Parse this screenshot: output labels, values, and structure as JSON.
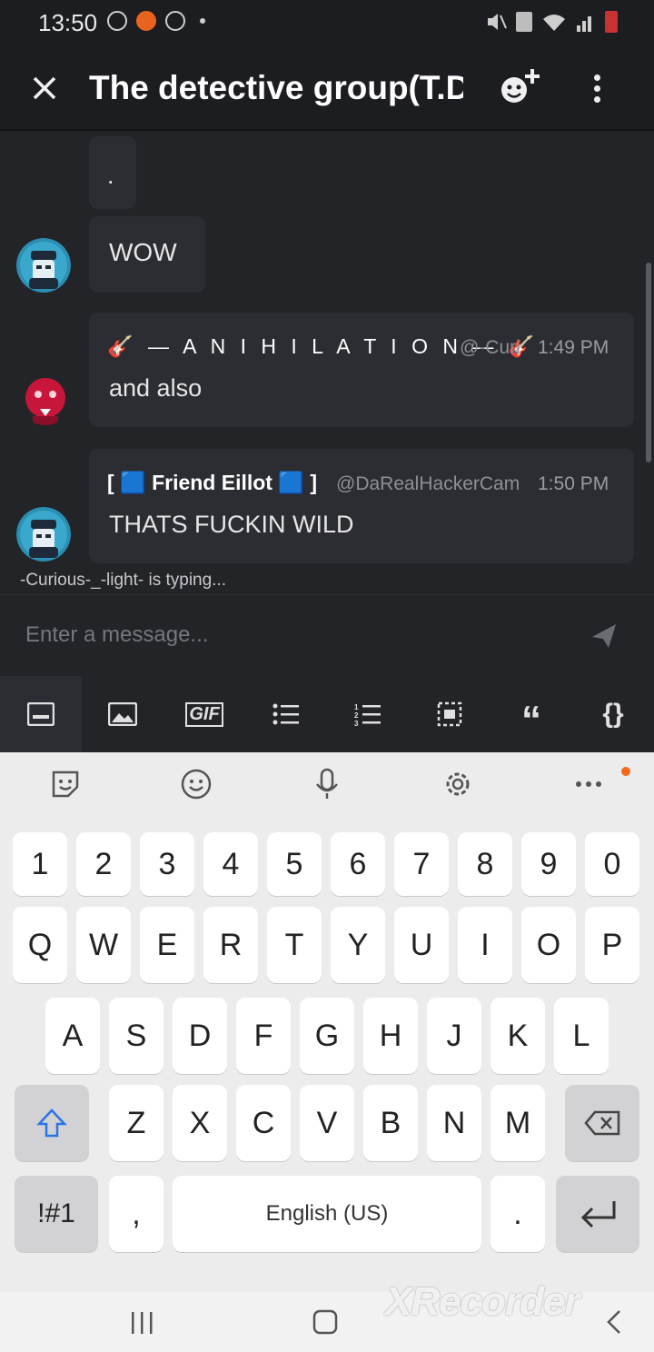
{
  "status": {
    "time": "13:50"
  },
  "header": {
    "title": "The detective group(T.D"
  },
  "messages": [
    {
      "text": "."
    },
    {
      "text": "WOW"
    },
    {
      "author": "🎸 — A N I H I L A T I O N — 🎸",
      "handle": "@-Curi",
      "time": "1:49 PM",
      "text": "and also"
    },
    {
      "author": "[ 🟦 Friend Eillot 🟦 ]",
      "handle": "@DaRealHackerCam",
      "time": "1:50 PM",
      "text": "THATS FUCKIN WILD"
    }
  ],
  "typing": "-Curious-_-light- is typing...",
  "composer": {
    "placeholder": "Enter a message..."
  },
  "toolbar": {
    "gif": "GIF",
    "quote": "“",
    "code": "{}"
  },
  "keyboard": {
    "numbers": [
      "1",
      "2",
      "3",
      "4",
      "5",
      "6",
      "7",
      "8",
      "9",
      "0"
    ],
    "row1": [
      "Q",
      "W",
      "E",
      "R",
      "T",
      "Y",
      "U",
      "I",
      "O",
      "P"
    ],
    "row2": [
      "A",
      "S",
      "D",
      "F",
      "G",
      "H",
      "J",
      "K",
      "L"
    ],
    "row3": [
      "Z",
      "X",
      "C",
      "V",
      "B",
      "N",
      "M"
    ],
    "symbols": "!#1",
    "comma": ",",
    "space": "English (US)",
    "period": "."
  },
  "watermark": "XRecorder",
  "colors": {
    "background": "#232428",
    "bubble": "#2c2d32",
    "accent_orange": "#f26b1d",
    "shift_blue": "#2a73e8"
  }
}
